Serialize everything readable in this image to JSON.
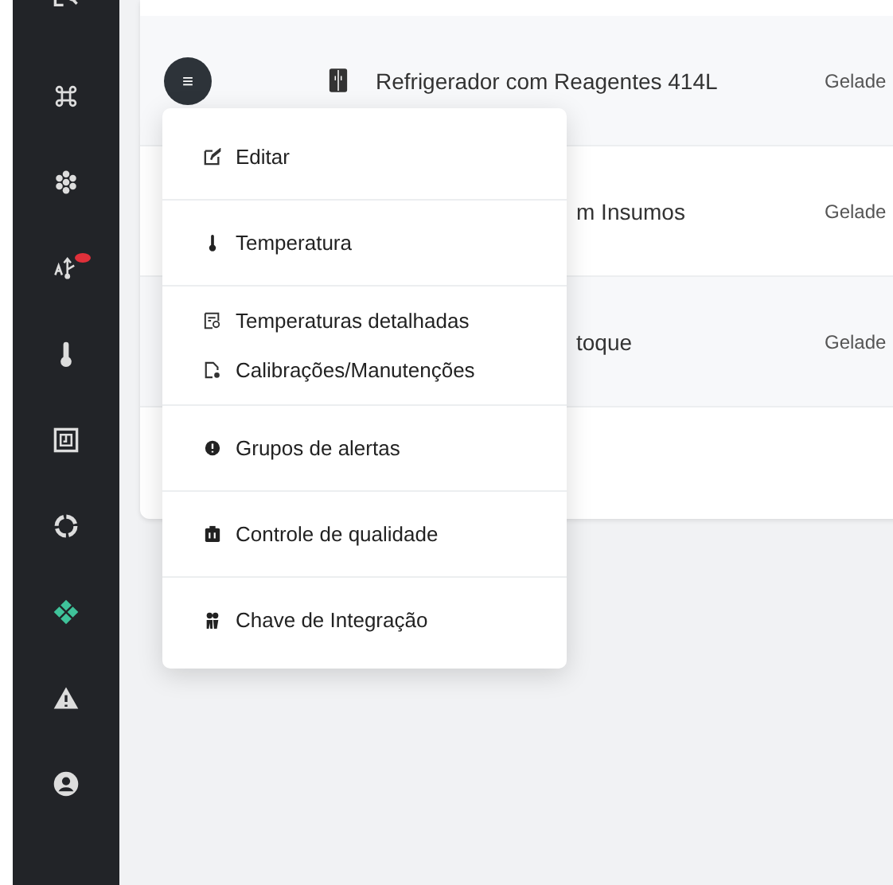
{
  "sidebar": {
    "items": [
      {
        "alert": false
      },
      {
        "alert": false
      },
      {
        "alert": false
      },
      {
        "alert": true
      },
      {
        "alert": false
      },
      {
        "alert": false
      },
      {
        "alert": false
      },
      {
        "alert": false
      },
      {
        "alert": false
      },
      {
        "alert": false
      }
    ]
  },
  "table": {
    "rows": [
      {
        "menu_button": "≡",
        "name": "Refrigerador com Reagentes 414L",
        "type": "Gelade"
      },
      {
        "name": "m Insumos",
        "type": "Gelade"
      },
      {
        "name": "toque",
        "type": "Gelade"
      }
    ]
  },
  "menu": {
    "groups": [
      [
        {
          "label": "Editar"
        }
      ],
      [
        {
          "label": "Temperatura"
        }
      ],
      [
        {
          "label": "Temperaturas detalhadas"
        },
        {
          "label": "Calibrações/Manutenções"
        }
      ],
      [
        {
          "label": "Grupos de alertas"
        }
      ],
      [
        {
          "label": "Controle de qualidade"
        }
      ],
      [
        {
          "label": "Chave de Integração"
        }
      ]
    ]
  }
}
